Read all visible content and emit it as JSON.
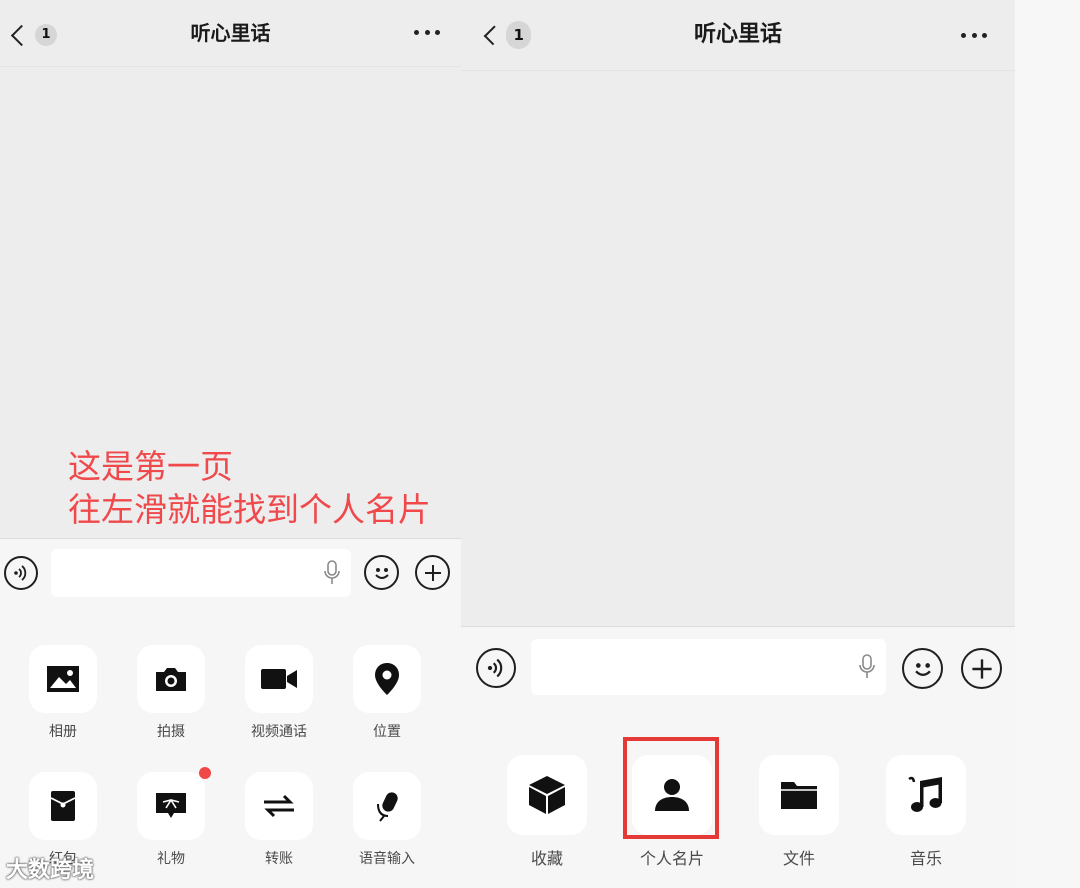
{
  "left_screen": {
    "back_badge": "1",
    "title": "听心里话",
    "annotation": [
      "这是第一页",
      "往左滑就能找到个人名片"
    ],
    "grid_items": [
      {
        "label": "相册",
        "icon": "photo-album-icon"
      },
      {
        "label": "拍摄",
        "icon": "camera-icon"
      },
      {
        "label": "视频通话",
        "icon": "video-call-icon"
      },
      {
        "label": "位置",
        "icon": "location-pin-icon"
      },
      {
        "label": "红包",
        "icon": "red-packet-icon"
      },
      {
        "label": "礼物",
        "icon": "gift-icon",
        "has_badge": true
      },
      {
        "label": "转账",
        "icon": "transfer-icon"
      },
      {
        "label": "语音输入",
        "icon": "voice-input-icon"
      }
    ]
  },
  "right_screen": {
    "back_badge": "1",
    "title": "听心里话",
    "grid_items": [
      {
        "label": "收藏",
        "icon": "favorites-cube-icon"
      },
      {
        "label": "个人名片",
        "icon": "contact-card-icon",
        "highlighted": true
      },
      {
        "label": "文件",
        "icon": "folder-icon"
      },
      {
        "label": "音乐",
        "icon": "music-note-icon"
      }
    ]
  },
  "watermark": "大数跨境",
  "colors": {
    "annotation": "#f0494c",
    "highlight": "#e53935",
    "badge_dot": "#f04848"
  }
}
